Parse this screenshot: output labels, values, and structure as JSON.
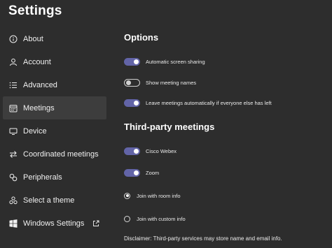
{
  "header": {
    "title": "Settings"
  },
  "sidebar": {
    "items": [
      {
        "label": "About"
      },
      {
        "label": "Account"
      },
      {
        "label": "Advanced"
      },
      {
        "label": "Meetings"
      },
      {
        "label": "Device"
      },
      {
        "label": "Coordinated meetings"
      },
      {
        "label": "Peripherals"
      },
      {
        "label": "Select a theme"
      },
      {
        "label": "Windows Settings"
      }
    ],
    "active": "Meetings"
  },
  "options": {
    "title": "Options",
    "toggles": [
      {
        "label": "Automatic screen sharing",
        "on": true
      },
      {
        "label": "Show meeting names",
        "on": false
      },
      {
        "label": "Leave meetings automatically if everyone else has left",
        "on": true
      }
    ]
  },
  "third_party": {
    "title": "Third-party meetings",
    "toggles": [
      {
        "label": "Cisco Webex",
        "on": true
      },
      {
        "label": "Zoom",
        "on": true
      }
    ],
    "radios": [
      {
        "label": "Join with room info",
        "checked": true
      },
      {
        "label": "Join with custom info",
        "checked": false
      }
    ],
    "disclaimer": "Disclaimer: Third-party services may store name and email info."
  },
  "colors": {
    "background": "#2d2d2d",
    "active_item": "#3d3d3d",
    "accent": "#6264a7",
    "text": "#ffffff"
  }
}
